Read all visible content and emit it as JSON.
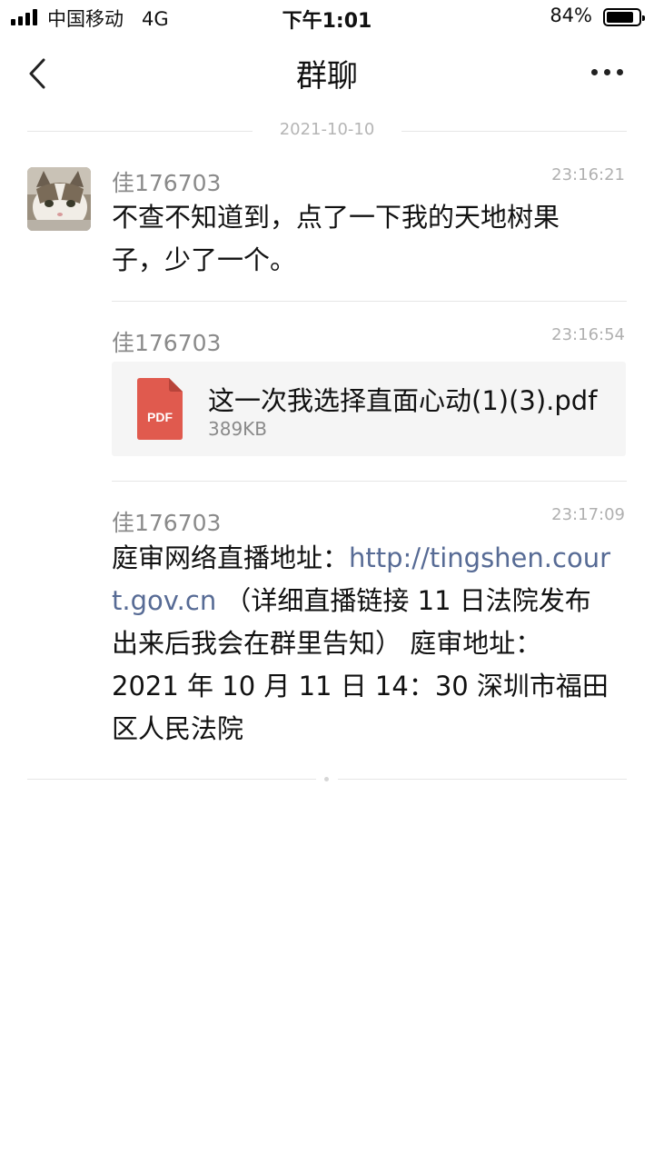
{
  "status_bar": {
    "carrier": "中国移动",
    "network": "4G",
    "time": "下午1:01",
    "battery_percent": "84%",
    "battery_level": 0.84
  },
  "nav": {
    "title": "群聊",
    "back_icon": "chevron-left-icon",
    "more_icon": "more-horizontal-icon"
  },
  "date_separator": "2021-10-10",
  "messages": [
    {
      "sender": "佳176703",
      "time": "23:16:21",
      "lines": [
        "不查不知道到，点了一下我的天地树果",
        "子，少了一个。"
      ]
    },
    {
      "sender": "佳176703",
      "time": "23:16:54",
      "file": {
        "name": "这一次我选择直面心动(1)(3).pdf",
        "size": "389KB",
        "type_label": "PDF"
      }
    },
    {
      "sender": "佳176703",
      "time": "23:17:09",
      "line1_text": "庭审网络直播地址：",
      "line1_link": "http://tingshen.cour",
      "line2_link": "t.gov.cn",
      "line2_text": " （详细直播链接 11 日法院发布",
      "line3": "出来后我会在群里告知） 庭审地址：",
      "line4": "2021 年 10 月 11 日 14：30 深圳市福田",
      "line5": "区人民法院"
    }
  ],
  "colors": {
    "link": "#576b95",
    "pdf_red": "#e05a4e",
    "card_bg": "#f5f5f5"
  }
}
